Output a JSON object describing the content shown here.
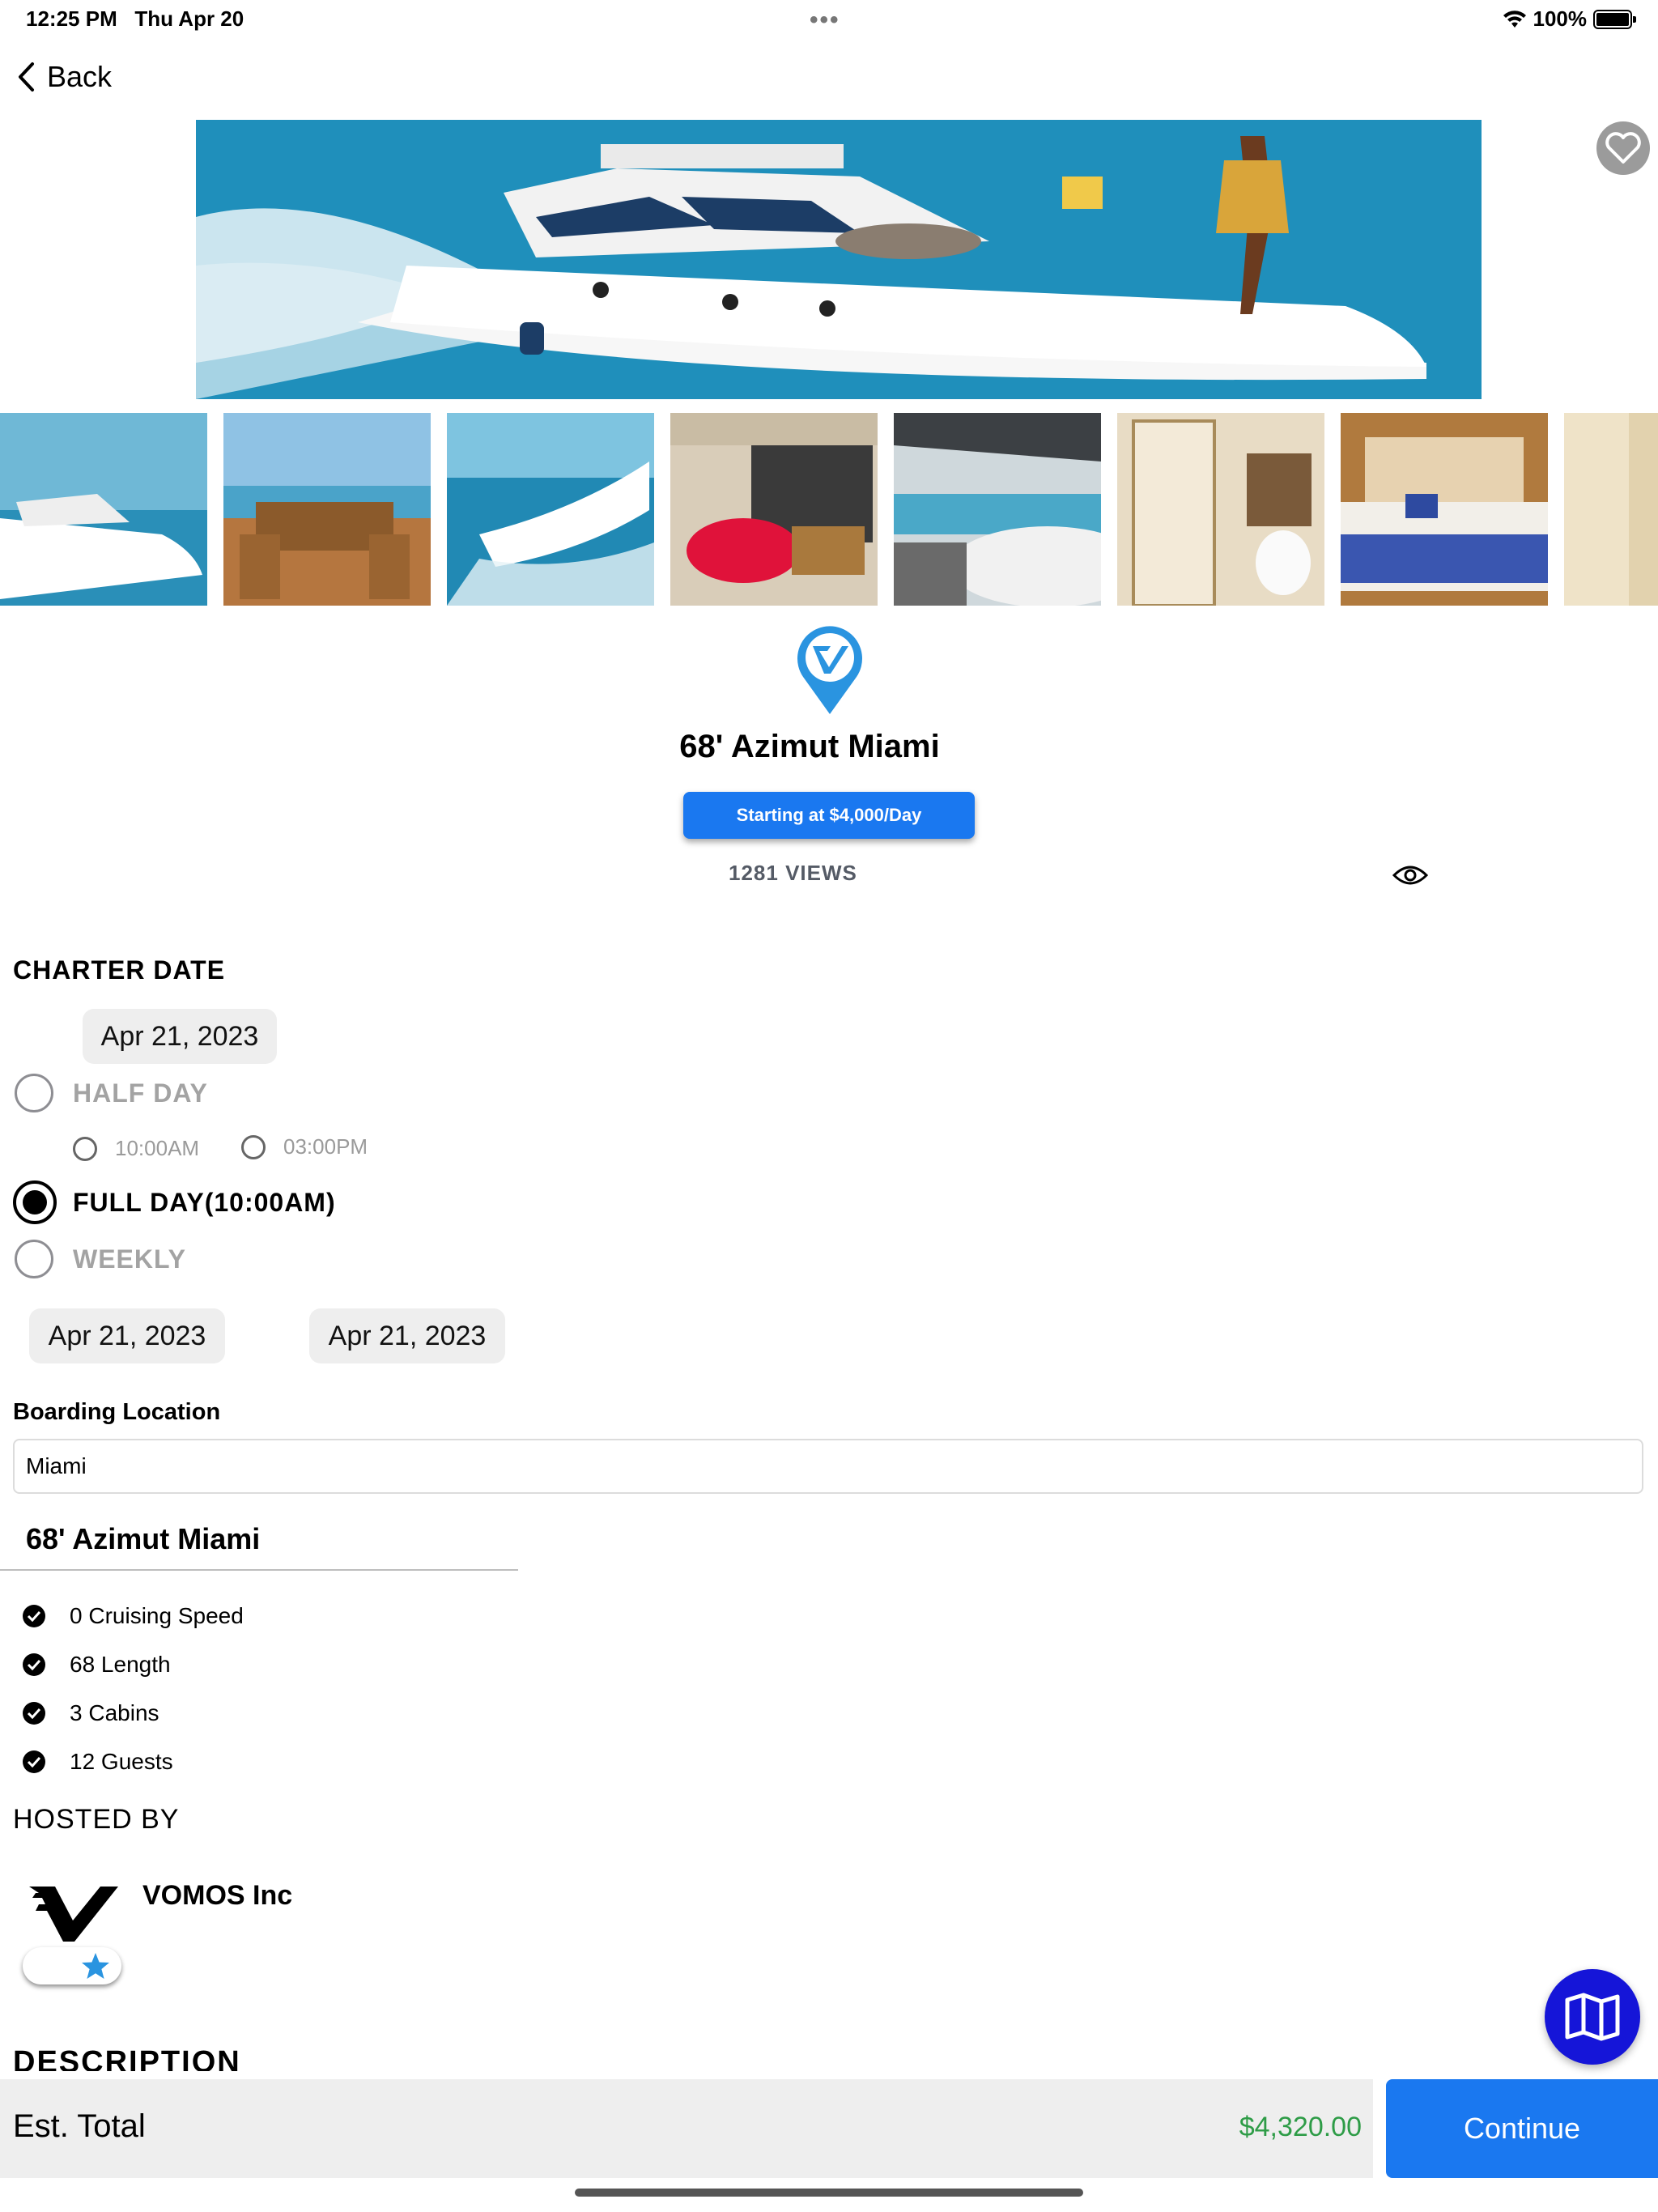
{
  "status_bar": {
    "time": "12:25 PM",
    "date": "Thu Apr 20",
    "dots": "•••",
    "battery": "100%"
  },
  "nav": {
    "back_label": "Back"
  },
  "listing": {
    "title": "68' Azimut Miami",
    "price_label": "Starting at $4,000/Day",
    "views": "1281 VIEWS"
  },
  "charter": {
    "heading": "CHARTER DATE",
    "date": "Apr 21, 2023",
    "options": {
      "half_day": "HALF DAY",
      "full_day": "FULL DAY(10:00AM)",
      "weekly": "WEEKLY"
    },
    "half_day_times": [
      "10:00AM",
      "03:00PM"
    ],
    "selected": "full_day",
    "weekly_start": "Apr 21, 2023",
    "weekly_end": "Apr 21, 2023"
  },
  "boarding": {
    "label": "Boarding Location",
    "value": "Miami"
  },
  "specs": {
    "name": "68' Azimut Miami",
    "items": [
      "0 Cruising Speed",
      "68 Length",
      "3 Cabins",
      "12 Guests"
    ]
  },
  "host": {
    "heading": "HOSTED BY",
    "name": "VOMOS Inc"
  },
  "description": {
    "heading": "DESCRIPTION"
  },
  "footer": {
    "est_label": "Est. Total",
    "est_value": "$4,320.00",
    "continue_label": "Continue"
  },
  "colors": {
    "accent": "#1a78f0",
    "fab": "#1515d8",
    "total": "#2e9c47",
    "pin": "#2a94e0"
  },
  "icons": [
    "chevron-left-icon",
    "heart-icon",
    "location-pin-icon",
    "eye-icon",
    "check-icon",
    "star-icon",
    "map-icon",
    "wifi-icon",
    "battery-icon"
  ]
}
